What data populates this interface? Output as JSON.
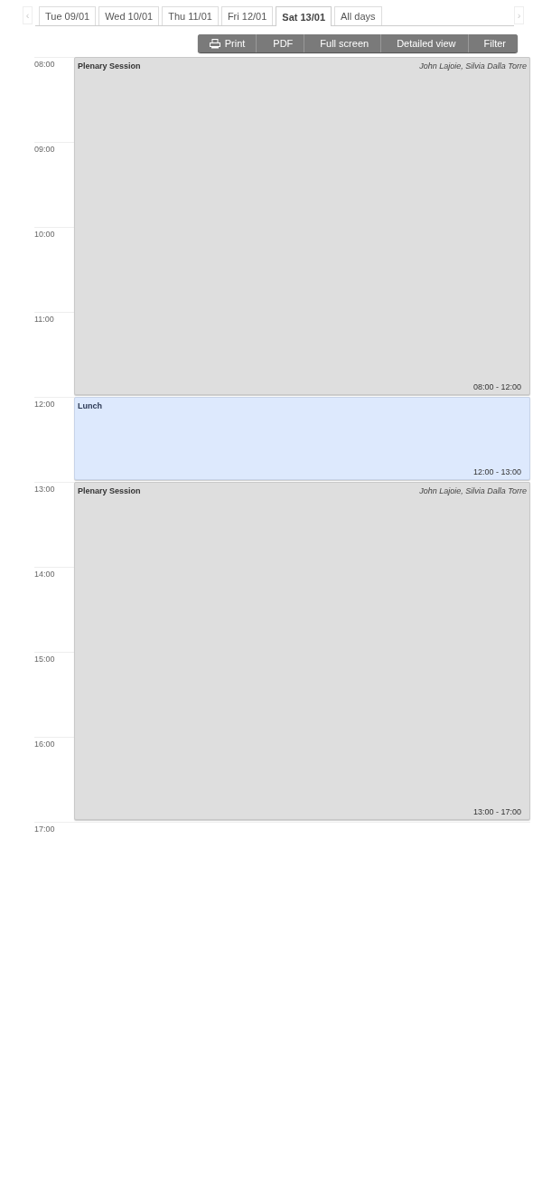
{
  "nav": {
    "prev": "‹",
    "next": "›"
  },
  "tabs": [
    {
      "label": "Tue 09/01",
      "selected": false
    },
    {
      "label": "Wed 10/01",
      "selected": false
    },
    {
      "label": "Thu 11/01",
      "selected": false
    },
    {
      "label": "Fri 12/01",
      "selected": false
    },
    {
      "label": "Sat 13/01",
      "selected": true
    },
    {
      "label": "All days",
      "selected": false
    }
  ],
  "toolbar": [
    {
      "label": "Print",
      "kind": "print"
    },
    {
      "label": "PDF",
      "kind": "plain"
    },
    {
      "label": "Full screen",
      "kind": "plain"
    },
    {
      "label": "Detailed view",
      "kind": "plain"
    },
    {
      "label": "Filter",
      "kind": "plain"
    }
  ],
  "hours": [
    "08:00",
    "09:00",
    "10:00",
    "11:00",
    "12:00",
    "13:00",
    "14:00",
    "15:00",
    "16:00",
    "17:00"
  ],
  "events": [
    {
      "title": "Plenary Session",
      "speakers": "John Lajoie, Silvia Dalla Torre",
      "time": "08:00 - 12:00",
      "kind": "session"
    },
    {
      "title": "Lunch",
      "time": "12:00 - 13:00",
      "kind": "break"
    },
    {
      "title": "Plenary Session",
      "speakers": "John Lajoie, Silvia Dalla Torre",
      "time": "13:00 - 17:00",
      "kind": "session"
    }
  ]
}
